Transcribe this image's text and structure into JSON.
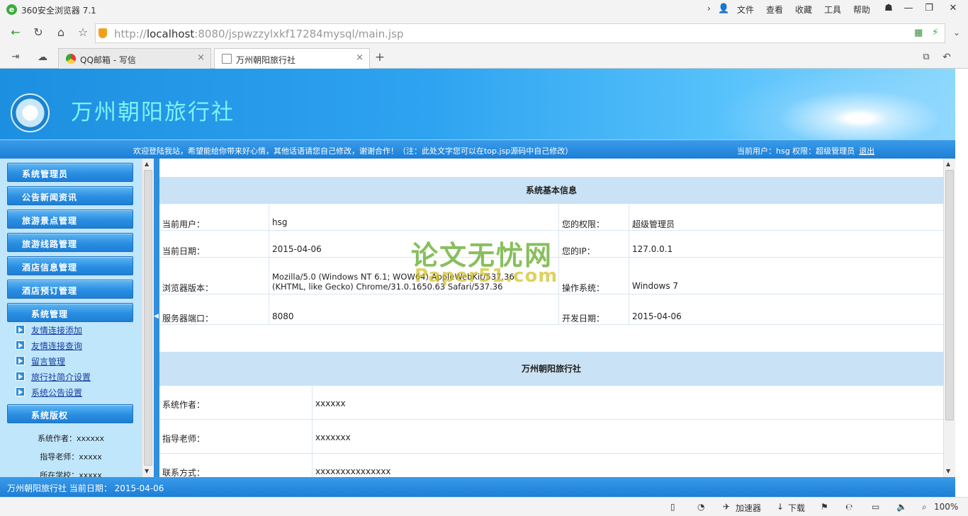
{
  "browser": {
    "app_title": "360安全浏览器 7.1",
    "menu": [
      "文件",
      "查看",
      "收藏",
      "工具",
      "帮助"
    ],
    "url_prefix": "http://",
    "url_host": "localhost",
    "url_rest": ":8080/jspwzzylxkf17284mysql/main.jsp",
    "tabs": [
      {
        "label": "QQ邮箱 - 写信"
      },
      {
        "label": "万州朝阳旅行社"
      }
    ],
    "status": {
      "accelerator": "加速器",
      "download": "下载",
      "zoom": "100%"
    }
  },
  "header": {
    "site_name": "万州朝阳旅行社",
    "welcome": "欢迎登陆我站，希望能给你带来好心情，其他话语请您自己修改，谢谢合作！（注：此处文字您可以在top.jsp源码中自己修改）",
    "current_user_text": "当前用户：hsg 权限：超级管理员",
    "logout": "退出"
  },
  "sidebar": {
    "menus": [
      "系统管理员",
      "公告新闻资讯",
      "旅游景点管理",
      "旅游线路管理",
      "酒店信息管理",
      "酒店预订管理"
    ],
    "system_title": "系统管理",
    "system_links": [
      "友情连接添加",
      "友情连接查询",
      "留言管理",
      "旅行社简介设置",
      "系统公告设置"
    ],
    "copyright_title": "系统版权",
    "copyright_lines": [
      "系统作者：xxxxxx",
      "指导老师：xxxxx",
      "所在学校：xxxxx"
    ]
  },
  "info": {
    "title": "系统基本信息",
    "current_user_label": "当前用户：",
    "current_user": "hsg",
    "permission_label": "您的权限：",
    "permission": "超级管理员",
    "date_label": "当前日期：",
    "date": "2015-04-06",
    "ip_label": "您的IP：",
    "ip": "127.0.0.1",
    "browser_label": "浏览器版本：",
    "browser_line1": "Mozilla/5.0 (Windows NT 6.1; WOW64) AppleWebKit/537.36",
    "browser_line2": "(KHTML, like Gecko) Chrome/31.0.1650.63 Safari/537.36",
    "os_label": "操作系统：",
    "os": "Windows 7",
    "port_label": "服务器端口：",
    "port": "8080",
    "dev_date_label": "开发日期：",
    "dev_date": "2015-04-06"
  },
  "about": {
    "title": "万州朝阳旅行社",
    "rows": [
      {
        "label": "系统作者：",
        "value": "xxxxxx"
      },
      {
        "label": "指导老师：",
        "value": "xxxxxxx"
      },
      {
        "label": "联系方式：",
        "value": "xxxxxxxxxxxxxxx"
      }
    ]
  },
  "watermark": {
    "line1": "论文无忧网",
    "line2": "Paper51.com"
  },
  "footer": {
    "text": "万州朝阳旅行社 当前日期：  2015-04-06"
  }
}
